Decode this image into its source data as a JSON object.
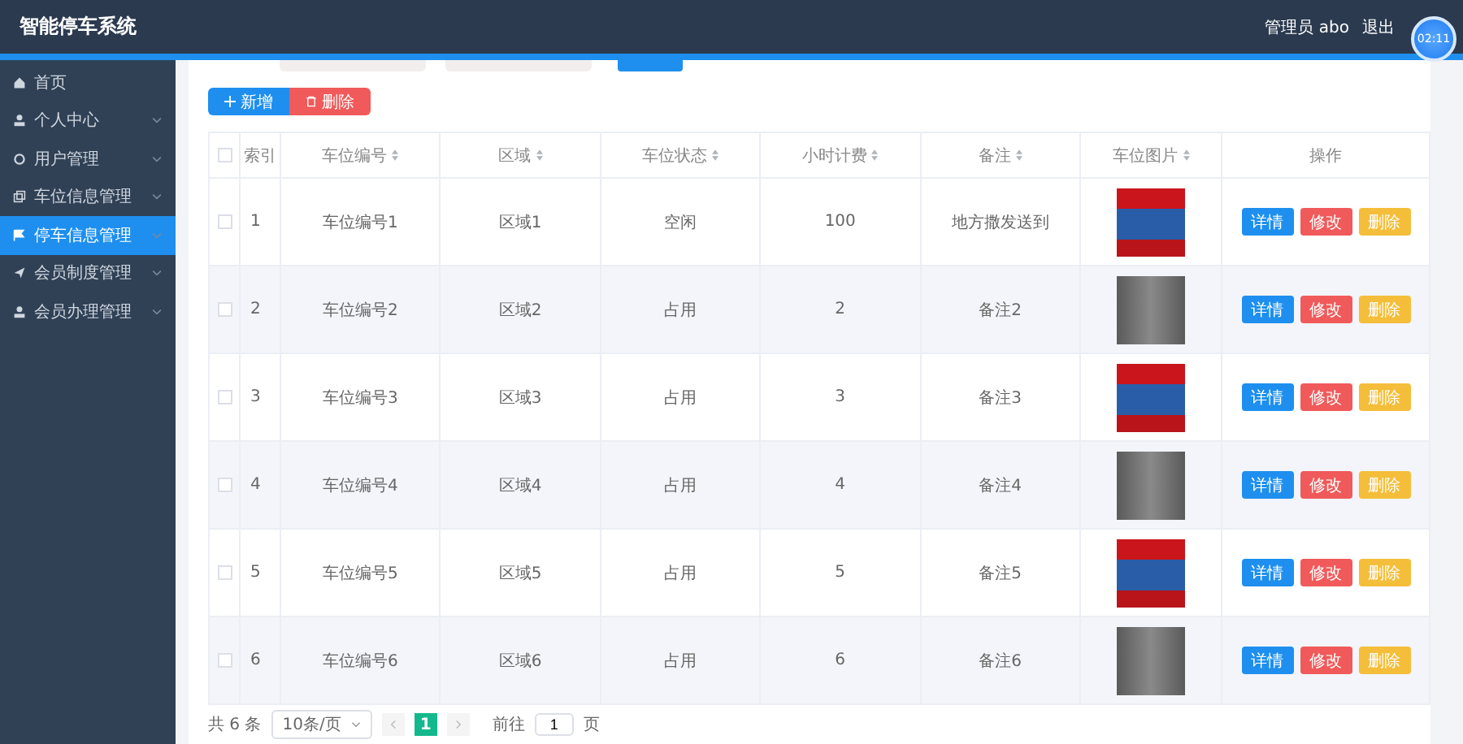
{
  "header": {
    "title": "智能停车系统",
    "user": "管理员 abo",
    "logout": "退出",
    "clock": "02:11"
  },
  "sidebar": {
    "items": [
      {
        "label": "首页",
        "selected": false,
        "expandable": false
      },
      {
        "label": "个人中心",
        "selected": false,
        "expandable": true
      },
      {
        "label": "用户管理",
        "selected": false,
        "expandable": true
      },
      {
        "label": "车位信息管理",
        "selected": false,
        "expandable": true
      },
      {
        "label": "停车信息管理",
        "selected": true,
        "expandable": true
      },
      {
        "label": "会员制度管理",
        "selected": false,
        "expandable": true
      },
      {
        "label": "会员办理管理",
        "selected": false,
        "expandable": true
      }
    ]
  },
  "toolbar": {
    "add": "新增",
    "delete": "删除"
  },
  "table": {
    "all_checked": false,
    "columns": [
      {
        "label": "索引",
        "sortable": false
      },
      {
        "label": "车位编号",
        "sortable": true
      },
      {
        "label": "区域",
        "sortable": true
      },
      {
        "label": "车位状态",
        "sortable": true
      },
      {
        "label": "小时计费",
        "sortable": true
      },
      {
        "label": "备注",
        "sortable": true
      },
      {
        "label": "车位图片",
        "sortable": true
      },
      {
        "label": "操作",
        "sortable": false
      }
    ],
    "rows": [
      {
        "index": "1",
        "code": "车位编号1",
        "area": "区域1",
        "status": "空闲",
        "fee": "100",
        "note": "地方撒发送到",
        "checked": false,
        "actions": [
          "详情",
          "修改",
          "删除"
        ]
      },
      {
        "index": "2",
        "code": "车位编号2",
        "area": "区域2",
        "status": "占用",
        "fee": "2",
        "note": "备注2",
        "checked": false,
        "actions": [
          "详情",
          "修改",
          "删除"
        ]
      },
      {
        "index": "3",
        "code": "车位编号3",
        "area": "区域3",
        "status": "占用",
        "fee": "3",
        "note": "备注3",
        "checked": false,
        "actions": [
          "详情",
          "修改",
          "删除"
        ]
      },
      {
        "index": "4",
        "code": "车位编号4",
        "area": "区域4",
        "status": "占用",
        "fee": "4",
        "note": "备注4",
        "checked": false,
        "actions": [
          "详情",
          "修改",
          "删除"
        ]
      },
      {
        "index": "5",
        "code": "车位编号5",
        "area": "区域5",
        "status": "占用",
        "fee": "5",
        "note": "备注5",
        "checked": false,
        "actions": [
          "详情",
          "修改",
          "删除"
        ]
      },
      {
        "index": "6",
        "code": "车位编号6",
        "area": "区域6",
        "status": "占用",
        "fee": "6",
        "note": "备注6",
        "checked": false,
        "actions": [
          "详情",
          "修改",
          "删除"
        ]
      }
    ]
  },
  "pagination": {
    "total": "共 6 条",
    "page_size": "10条/页",
    "current": "1",
    "goto": "前往",
    "goto_value": "1",
    "page_unit": "页"
  }
}
